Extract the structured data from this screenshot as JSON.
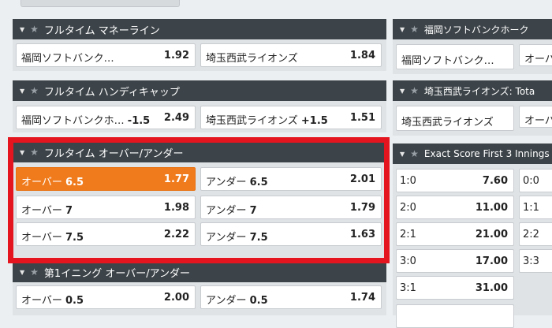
{
  "panel_money": {
    "title": "フルタイム マネーライン",
    "cells": [
      {
        "label": "福岡ソフトバンク…",
        "line": "",
        "odds": "1.92"
      },
      {
        "label": "埼玉西武ライオンズ",
        "line": "",
        "odds": "1.84"
      }
    ]
  },
  "panel_handicap": {
    "title": "フルタイム ハンディキャップ",
    "cells": [
      {
        "label": "福岡ソフトバンクホ…",
        "line": "-1.5",
        "odds": "2.49"
      },
      {
        "label": "埼玉西武ライオンズ",
        "line": "+1.5",
        "odds": "1.51"
      }
    ]
  },
  "panel_ou": {
    "title": "フルタイム オーバー/アンダー",
    "rows": [
      [
        {
          "label": "オーバー",
          "line": "6.5",
          "odds": "1.77",
          "selected": true
        },
        {
          "label": "アンダー",
          "line": "6.5",
          "odds": "2.01"
        }
      ],
      [
        {
          "label": "オーバー",
          "line": "7",
          "odds": "1.98"
        },
        {
          "label": "アンダー",
          "line": "7",
          "odds": "1.79"
        }
      ],
      [
        {
          "label": "オーバー",
          "line": "7.5",
          "odds": "2.22"
        },
        {
          "label": "アンダー",
          "line": "7.5",
          "odds": "1.63"
        }
      ]
    ]
  },
  "panel_first_innings": {
    "title": "第1イニング オーバー/アンダー",
    "cells": [
      {
        "label": "オーバー",
        "line": "0.5",
        "odds": "2.00"
      },
      {
        "label": "アンダー",
        "line": "0.5",
        "odds": "1.74"
      }
    ]
  },
  "right_panel_1": {
    "title": "福岡ソフトバンクホーク",
    "cells": [
      {
        "label": "福岡ソフトバンク…"
      },
      {
        "label": "オーバ"
      }
    ]
  },
  "right_panel_2": {
    "title": "埼玉西武ライオンズ: Tota",
    "cells": [
      {
        "label": "埼玉西武ライオンズ"
      },
      {
        "label": "オーバ"
      }
    ]
  },
  "exact_score": {
    "title": "Exact Score First 3 Innings",
    "rows": [
      [
        {
          "score": "1:0",
          "odds": "7.60"
        },
        {
          "score": "0:0"
        }
      ],
      [
        {
          "score": "2:0",
          "odds": "11.00"
        },
        {
          "score": "1:1"
        }
      ],
      [
        {
          "score": "2:1",
          "odds": "21.00"
        },
        {
          "score": "2:2"
        }
      ],
      [
        {
          "score": "3:0",
          "odds": "17.00"
        },
        {
          "score": "3:3"
        }
      ],
      [
        {
          "score": "3:1",
          "odds": "31.00"
        }
      ]
    ]
  },
  "icons": {
    "collapse": "▼",
    "star": "★"
  },
  "colors": {
    "header_bg": "#3d4449",
    "selected": "#f07b1d",
    "highlight_box": "#e4151f"
  }
}
